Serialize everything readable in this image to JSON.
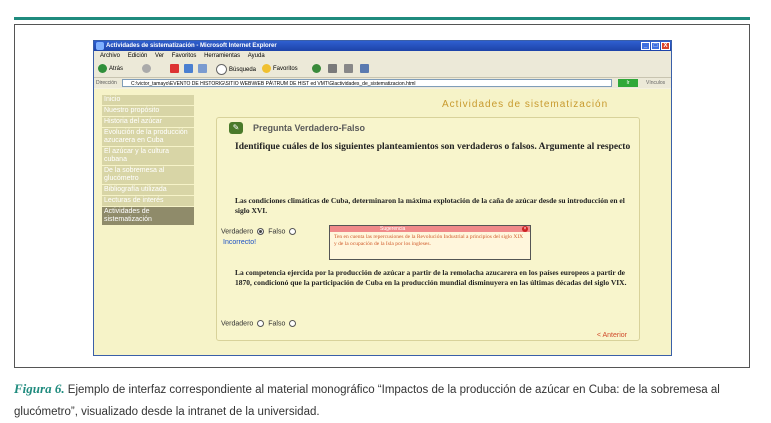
{
  "window": {
    "title": "Actividades de sistematización - Microsoft Internet Explorer",
    "buttons": [
      "_",
      "□",
      "X"
    ]
  },
  "menubar": [
    "Archivo",
    "Edición",
    "Ver",
    "Favoritos",
    "Herramientas",
    "Ayuda"
  ],
  "toolbar": {
    "back": "Atrás",
    "search": "Búsqueda",
    "favorites": "Favoritos"
  },
  "address": {
    "label": "Dirección",
    "value": "C:\\victor_tamayo\\EVENTO DE HISTORIG\\SITIO WEB\\WEB PÁ\\TRUM DE HIST ed VMT\\Glactividades_de_sistematizacion.html",
    "go": "Ir",
    "links": "Vínculos"
  },
  "page": {
    "header": "Actividades de sistematización",
    "sidebar": [
      "Inicio",
      "Nuestro propósito",
      "Historia del azúcar",
      "Evolución de la producción azucarera en Cuba",
      "El azúcar y la cultura cubana",
      "De la sobremesa al glucómetro",
      "Bibliografía utilizada",
      "Lecturas de interés",
      "Actividades de sistematización"
    ],
    "question_type": "Pregunta Verdadero-Falso",
    "instruction": "Identifique cuáles de los siguientes planteamientos son verdaderos o falsos. Argumente al respecto",
    "q1": "Las condiciones climáticas de Cuba, determinaron la máxima explotación de la caña de azúcar desde su introducción en el siglo XVI.",
    "true_label": "Verdadero",
    "false_label": "Falso",
    "incorrect": "Incorrecto!",
    "tip_title": "Sugerencia",
    "tip_text": "Ten en cuenta las repercusiones de la Revolución Industrial a principios del siglo XIX y de la ocupación de la Isla por los ingleses.",
    "q2": "La competencia ejercida por la producción de azúcar a partir de la remolacha azucarera en los países europeos a partir de 1870, condicionó que la participación de Cuba en la producción mundial disminuyera en las últimas décadas del siglo VIX.",
    "prev": "< Anterior"
  },
  "caption": {
    "label": "Figura 6.",
    "text": "Ejemplo de interfaz correspondiente al material monográfico “Impactos de la producción de azúcar en Cuba: de la sobremesa al glucómetro”, visualizado desde la intranet de la universidad."
  }
}
